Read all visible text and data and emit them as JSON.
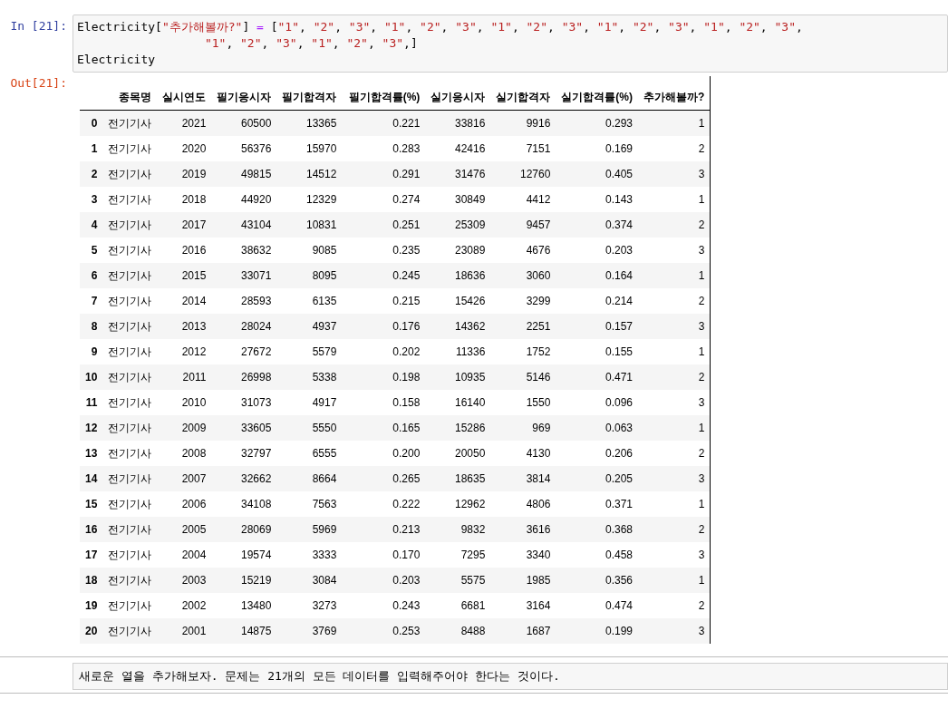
{
  "input_prompt": "In [21]:",
  "code_lines": [
    [
      {
        "kind": "name",
        "text": "Electricity["
      },
      {
        "kind": "string",
        "text": "\"추가해볼까?\""
      },
      {
        "kind": "name",
        "text": "] "
      },
      {
        "kind": "op",
        "text": "="
      },
      {
        "kind": "name",
        "text": " ["
      },
      {
        "kind": "string",
        "text": "\"1\""
      },
      {
        "kind": "name",
        "text": ", "
      },
      {
        "kind": "string",
        "text": "\"2\""
      },
      {
        "kind": "name",
        "text": ", "
      },
      {
        "kind": "string",
        "text": "\"3\""
      },
      {
        "kind": "name",
        "text": ", "
      },
      {
        "kind": "string",
        "text": "\"1\""
      },
      {
        "kind": "name",
        "text": ", "
      },
      {
        "kind": "string",
        "text": "\"2\""
      },
      {
        "kind": "name",
        "text": ", "
      },
      {
        "kind": "string",
        "text": "\"3\""
      },
      {
        "kind": "name",
        "text": ", "
      },
      {
        "kind": "string",
        "text": "\"1\""
      },
      {
        "kind": "name",
        "text": ", "
      },
      {
        "kind": "string",
        "text": "\"2\""
      },
      {
        "kind": "name",
        "text": ", "
      },
      {
        "kind": "string",
        "text": "\"3\""
      },
      {
        "kind": "name",
        "text": ", "
      },
      {
        "kind": "string",
        "text": "\"1\""
      },
      {
        "kind": "name",
        "text": ", "
      },
      {
        "kind": "string",
        "text": "\"2\""
      },
      {
        "kind": "name",
        "text": ", "
      },
      {
        "kind": "string",
        "text": "\"3\""
      },
      {
        "kind": "name",
        "text": ", "
      },
      {
        "kind": "string",
        "text": "\"1\""
      },
      {
        "kind": "name",
        "text": ", "
      },
      {
        "kind": "string",
        "text": "\"2\""
      },
      {
        "kind": "name",
        "text": ", "
      },
      {
        "kind": "string",
        "text": "\"3\""
      },
      {
        "kind": "name",
        "text": ","
      }
    ],
    [
      {
        "kind": "string",
        "text": "                  \"1\""
      },
      {
        "kind": "name",
        "text": ", "
      },
      {
        "kind": "string",
        "text": "\"2\""
      },
      {
        "kind": "name",
        "text": ", "
      },
      {
        "kind": "string",
        "text": "\"3\""
      },
      {
        "kind": "name",
        "text": ", "
      },
      {
        "kind": "string",
        "text": "\"1\""
      },
      {
        "kind": "name",
        "text": ", "
      },
      {
        "kind": "string",
        "text": "\"2\""
      },
      {
        "kind": "name",
        "text": ", "
      },
      {
        "kind": "string",
        "text": "\"3\""
      },
      {
        "kind": "name",
        "text": ",]"
      }
    ],
    [
      {
        "kind": "name",
        "text": "Electricity"
      }
    ]
  ],
  "output_prompt": "Out[21]:",
  "table": {
    "columns": [
      "종목명",
      "실시연도",
      "필기응시자",
      "필기합격자",
      "필기합격률(%)",
      "실기응시자",
      "실기합격자",
      "실기합격률(%)",
      "추가해볼까?"
    ],
    "rows": [
      {
        "index": "0",
        "cells": [
          "전기기사",
          "2021",
          "60500",
          "13365",
          "0.221",
          "33816",
          "9916",
          "0.293",
          "1"
        ]
      },
      {
        "index": "1",
        "cells": [
          "전기기사",
          "2020",
          "56376",
          "15970",
          "0.283",
          "42416",
          "7151",
          "0.169",
          "2"
        ]
      },
      {
        "index": "2",
        "cells": [
          "전기기사",
          "2019",
          "49815",
          "14512",
          "0.291",
          "31476",
          "12760",
          "0.405",
          "3"
        ]
      },
      {
        "index": "3",
        "cells": [
          "전기기사",
          "2018",
          "44920",
          "12329",
          "0.274",
          "30849",
          "4412",
          "0.143",
          "1"
        ]
      },
      {
        "index": "4",
        "cells": [
          "전기기사",
          "2017",
          "43104",
          "10831",
          "0.251",
          "25309",
          "9457",
          "0.374",
          "2"
        ]
      },
      {
        "index": "5",
        "cells": [
          "전기기사",
          "2016",
          "38632",
          "9085",
          "0.235",
          "23089",
          "4676",
          "0.203",
          "3"
        ]
      },
      {
        "index": "6",
        "cells": [
          "전기기사",
          "2015",
          "33071",
          "8095",
          "0.245",
          "18636",
          "3060",
          "0.164",
          "1"
        ]
      },
      {
        "index": "7",
        "cells": [
          "전기기사",
          "2014",
          "28593",
          "6135",
          "0.215",
          "15426",
          "3299",
          "0.214",
          "2"
        ]
      },
      {
        "index": "8",
        "cells": [
          "전기기사",
          "2013",
          "28024",
          "4937",
          "0.176",
          "14362",
          "2251",
          "0.157",
          "3"
        ]
      },
      {
        "index": "9",
        "cells": [
          "전기기사",
          "2012",
          "27672",
          "5579",
          "0.202",
          "11336",
          "1752",
          "0.155",
          "1"
        ]
      },
      {
        "index": "10",
        "cells": [
          "전기기사",
          "2011",
          "26998",
          "5338",
          "0.198",
          "10935",
          "5146",
          "0.471",
          "2"
        ]
      },
      {
        "index": "11",
        "cells": [
          "전기기사",
          "2010",
          "31073",
          "4917",
          "0.158",
          "16140",
          "1550",
          "0.096",
          "3"
        ]
      },
      {
        "index": "12",
        "cells": [
          "전기기사",
          "2009",
          "33605",
          "5550",
          "0.165",
          "15286",
          "969",
          "0.063",
          "1"
        ]
      },
      {
        "index": "13",
        "cells": [
          "전기기사",
          "2008",
          "32797",
          "6555",
          "0.200",
          "20050",
          "4130",
          "0.206",
          "2"
        ]
      },
      {
        "index": "14",
        "cells": [
          "전기기사",
          "2007",
          "32662",
          "8664",
          "0.265",
          "18635",
          "3814",
          "0.205",
          "3"
        ]
      },
      {
        "index": "15",
        "cells": [
          "전기기사",
          "2006",
          "34108",
          "7563",
          "0.222",
          "12962",
          "4806",
          "0.371",
          "1"
        ]
      },
      {
        "index": "16",
        "cells": [
          "전기기사",
          "2005",
          "28069",
          "5969",
          "0.213",
          "9832",
          "3616",
          "0.368",
          "2"
        ]
      },
      {
        "index": "17",
        "cells": [
          "전기기사",
          "2004",
          "19574",
          "3333",
          "0.170",
          "7295",
          "3340",
          "0.458",
          "3"
        ]
      },
      {
        "index": "18",
        "cells": [
          "전기기사",
          "2003",
          "15219",
          "3084",
          "0.203",
          "5575",
          "1985",
          "0.356",
          "1"
        ]
      },
      {
        "index": "19",
        "cells": [
          "전기기사",
          "2002",
          "13480",
          "3273",
          "0.243",
          "6681",
          "3164",
          "0.474",
          "2"
        ]
      },
      {
        "index": "20",
        "cells": [
          "전기기사",
          "2001",
          "14875",
          "3769",
          "0.253",
          "8488",
          "1687",
          "0.199",
          "3"
        ]
      }
    ]
  },
  "markdown": "새로운 열을 추가해보자. 문제는 21개의 모든 데이터를 입력해주어야 한다는 것이다."
}
